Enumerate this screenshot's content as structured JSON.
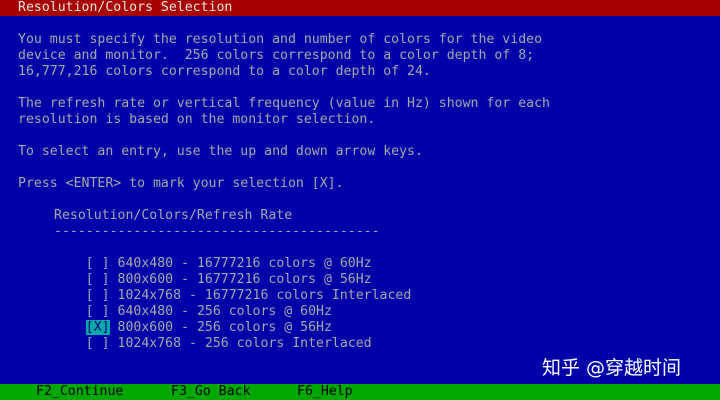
{
  "title": "Resolution/Colors Selection",
  "intro": [
    "You must specify the resolution and number of colors for the video",
    "device and monitor.  256 colors correspond to a color depth of 8;",
    "16,777,216 colors correspond to a color depth of 24."
  ],
  "refresh_note": [
    "The refresh rate or vertical frequency (value in Hz) shown for each",
    "resolution is based on the monitor selection."
  ],
  "instruction_select": "To select an entry, use the up and down arrow keys.",
  "instruction_mark": "Press <ENTER> to mark your selection [X].",
  "list": {
    "header": "Resolution/Colors/Refresh Rate",
    "separator": "-----------------------------------------",
    "items": [
      {
        "checkbox": "[ ]",
        "label": "640x480 - 16777216 colors @ 60Hz"
      },
      {
        "checkbox": "[ ]",
        "label": "800x600 - 16777216 colors @ 56Hz"
      },
      {
        "checkbox": "[ ]",
        "label": "1024x768 - 16777216 colors Interlaced"
      },
      {
        "checkbox": "[ ]",
        "label": "640x480 - 256 colors @ 60Hz"
      },
      {
        "checkbox": "[X]",
        "label": "800x600 - 256 colors @ 56Hz"
      },
      {
        "checkbox": "[ ]",
        "label": "1024x768 - 256 colors Interlaced"
      }
    ]
  },
  "watermark": "知乎 @穿越时间",
  "footer": {
    "continue": "F2_Continue",
    "go_back": "F3_Go Back",
    "help": "F6_Help"
  },
  "colors": {
    "background": "#0000a8",
    "title_bar": "#a80000",
    "footer_bar": "#00a800",
    "selection": "#00a8a8",
    "text": "#a8a8a8"
  }
}
